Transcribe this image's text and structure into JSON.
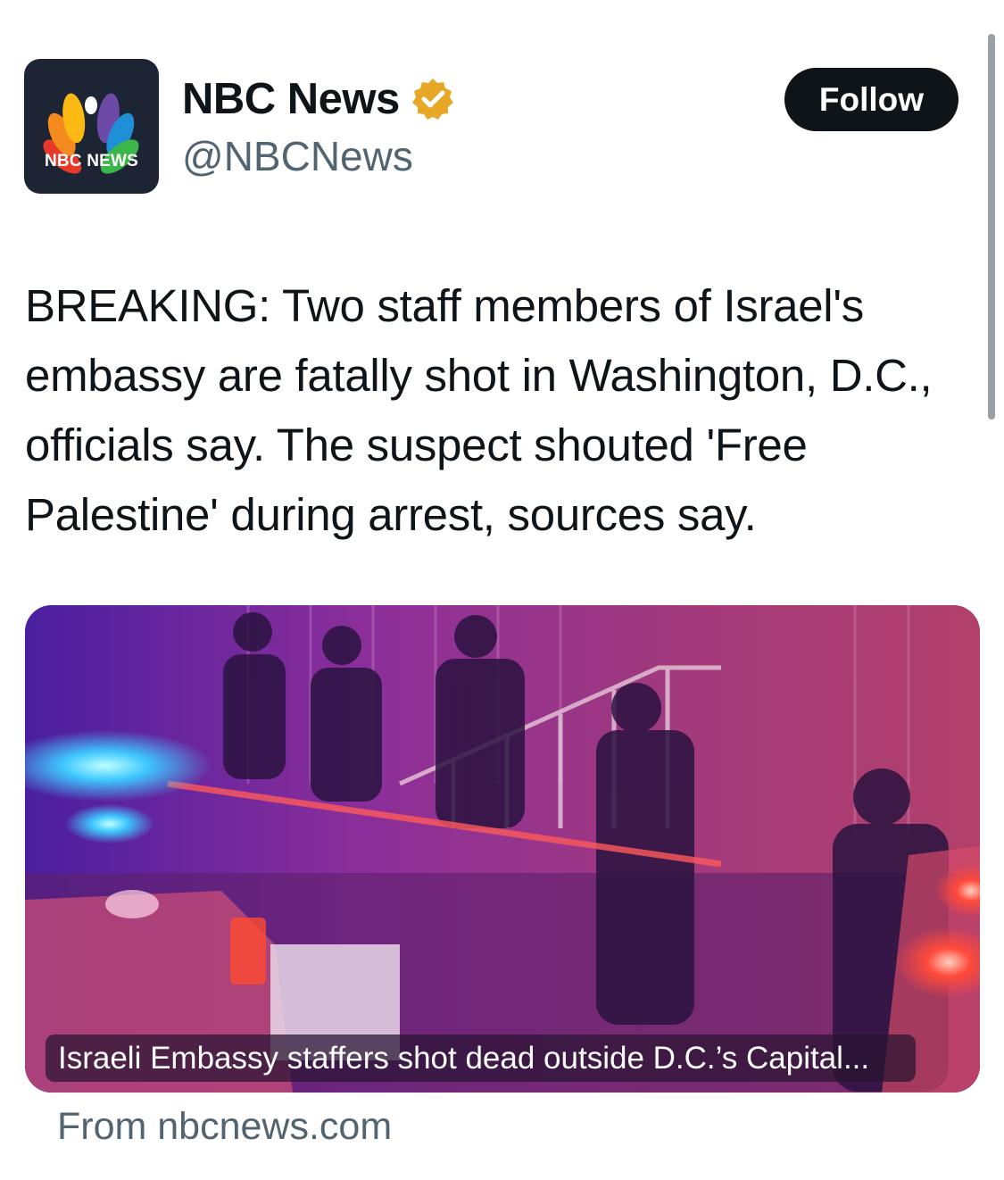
{
  "author": {
    "display_name": "NBC News",
    "handle": "@NBCNews",
    "avatar_text": "NBC NEWS",
    "avatar_icon": "nbc-peacock-logo",
    "verified_icon": "verified-badge-icon",
    "verified_color": "#e8a827"
  },
  "actions": {
    "follow_label": "Follow"
  },
  "tweet": {
    "text": "BREAKING: Two staff members of Israel's embassy are fatally shot in Washington, D.C., officials say. The suspect shouted 'Free Palestine' during arrest, sources say."
  },
  "card": {
    "caption": "Israeli Embassy staffers shot dead outside D.C.’s Capital...",
    "source": "From nbcnews.com"
  },
  "colors": {
    "text_primary": "#0f1419",
    "text_secondary": "#536471",
    "button_bg": "#0f1419",
    "button_text": "#ffffff"
  }
}
